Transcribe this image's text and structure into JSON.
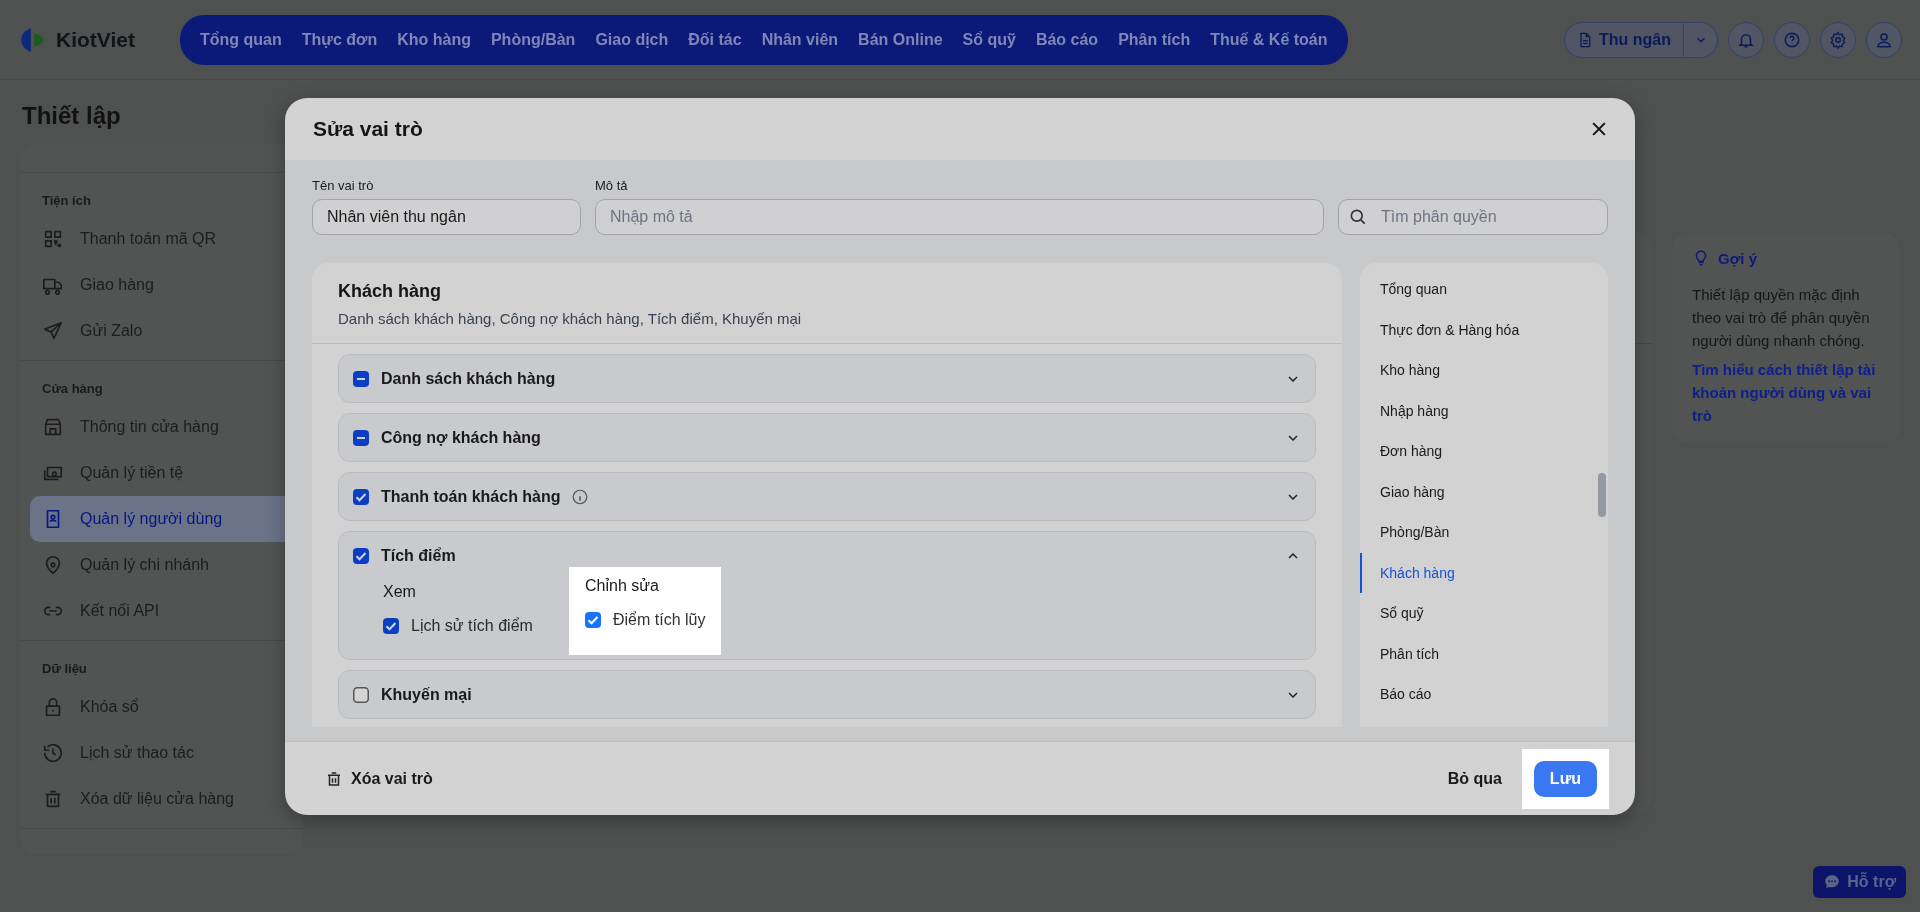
{
  "brand": "KiotViet",
  "nav": [
    {
      "label": "Tổng quan"
    },
    {
      "label": "Thực đơn"
    },
    {
      "label": "Kho hàng"
    },
    {
      "label": "Phòng/Bàn"
    },
    {
      "label": "Giao dịch"
    },
    {
      "label": "Đối tác"
    },
    {
      "label": "Nhân viên"
    },
    {
      "label": "Bán Online"
    },
    {
      "label": "Sổ quỹ"
    },
    {
      "label": "Báo cáo"
    },
    {
      "label": "Phân tích"
    },
    {
      "label": "Thuế & Kế toán"
    }
  ],
  "role_switch": "Thu ngân",
  "page_title": "Thiết lập",
  "sidebar": [
    {
      "heading": "Tiện ích",
      "items": [
        {
          "label": "Thanh toán mã QR",
          "selected": false
        },
        {
          "label": "Giao hàng",
          "selected": false
        },
        {
          "label": "Gửi Zalo",
          "selected": false
        }
      ]
    },
    {
      "heading": "Cửa hàng",
      "items": [
        {
          "label": "Thông tin cửa hàng",
          "selected": false
        },
        {
          "label": "Quản lý tiền tệ",
          "selected": false
        },
        {
          "label": "Quản lý người dùng",
          "selected": true
        },
        {
          "label": "Quản lý chi nhánh",
          "selected": false
        },
        {
          "label": "Kết nối API",
          "selected": false
        }
      ]
    },
    {
      "heading": "Dữ liệu",
      "items": [
        {
          "label": "Khóa sổ",
          "selected": false
        },
        {
          "label": "Lịch sử thao tác",
          "selected": false
        },
        {
          "label": "Xóa dữ liệu cửa hàng",
          "selected": false
        }
      ]
    }
  ],
  "hint": {
    "title": "Gợi ý",
    "text": "Thiết lập quyền mặc định theo vai trò để phân quyền người dùng nhanh chóng.",
    "link": "Tìm hiểu cách thiết lập tài khoản người dùng và vai trò"
  },
  "support": "Hỗ trợ",
  "modal": {
    "title": "Sửa vai trò",
    "role_name": {
      "label": "Tên vai trò",
      "value": "Nhân viên thu ngân"
    },
    "description": {
      "label": "Mô tả",
      "placeholder": "Nhập mô tả"
    },
    "search": {
      "placeholder": "Tìm phân quyền"
    },
    "group": {
      "title": "Khách hàng",
      "subtitle": "Danh sách khách hàng, Công nợ khách hàng, Tích điểm, Khuyến mại"
    },
    "permissions": [
      {
        "label": "Danh sách khách hàng",
        "checked": false,
        "partial": true,
        "info": false,
        "expanded": false
      },
      {
        "label": "Công nợ khách hàng",
        "checked": false,
        "partial": true,
        "info": false,
        "expanded": false
      },
      {
        "label": "Thanh toán khách hàng",
        "checked": true,
        "partial": false,
        "info": true,
        "expanded": false
      },
      {
        "label": "Tích điểm",
        "checked": true,
        "partial": false,
        "info": false,
        "expanded": true,
        "columns": [
          {
            "title": "Xem",
            "highlighted": false,
            "options": [
              {
                "label": "Lịch sử tích điểm",
                "checked": true
              }
            ]
          },
          {
            "title": "Chỉnh sửa",
            "highlighted": true,
            "options": [
              {
                "label": "Điểm tích lũy",
                "checked": true
              }
            ]
          }
        ]
      },
      {
        "label": "Khuyến mại",
        "checked": false,
        "partial": false,
        "info": false,
        "expanded": false
      }
    ],
    "sections": [
      {
        "label": "Tổng quan",
        "selected": false
      },
      {
        "label": "Thực đơn & Hàng hóa",
        "selected": false
      },
      {
        "label": "Kho hàng",
        "selected": false
      },
      {
        "label": "Nhập hàng",
        "selected": false
      },
      {
        "label": "Đơn hàng",
        "selected": false
      },
      {
        "label": "Giao hàng",
        "selected": false
      },
      {
        "label": "Phòng/Bàn",
        "selected": false
      },
      {
        "label": "Khách hàng",
        "selected": true
      },
      {
        "label": "Sổ quỹ",
        "selected": false
      },
      {
        "label": "Phân tích",
        "selected": false
      },
      {
        "label": "Báo cáo",
        "selected": false
      }
    ],
    "delete": "Xóa vai trò",
    "cancel": "Bỏ qua",
    "save": {
      "label": "Lưu",
      "highlighted": true
    }
  }
}
